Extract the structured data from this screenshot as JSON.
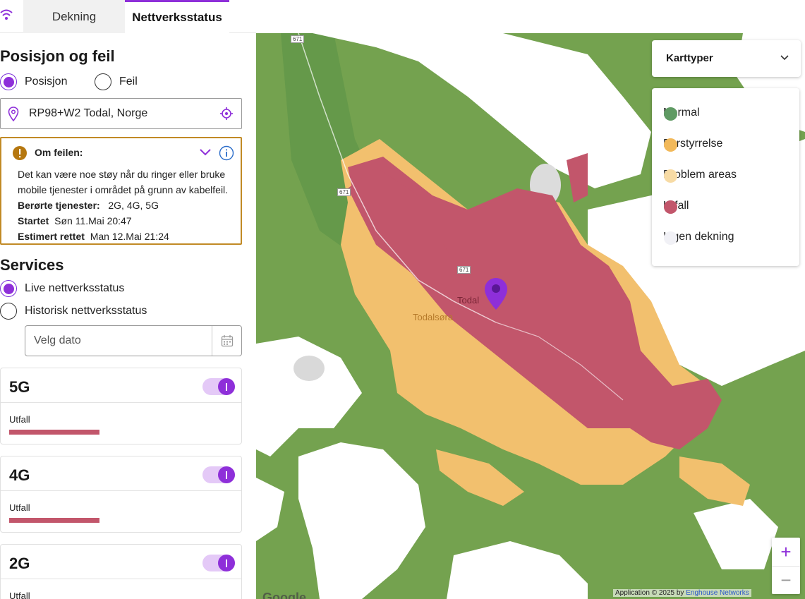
{
  "tabs": {
    "coverage": "Dekning",
    "network_status": "Nettverksstatus"
  },
  "position_section": {
    "title": "Posisjon og feil",
    "radio_position": "Posisjon",
    "radio_fault": "Feil",
    "location_value": "RP98+W2 Todal, Norge"
  },
  "alert": {
    "title": "Om feilen:",
    "message": "Det kan være noe støy når du ringer eller bruke mobile tjenester i området på grunn av kabelfeil.",
    "services_label": "Berørte tjenester:",
    "services_value": "2G, 4G, 5G",
    "started_label": "Startet",
    "started_value": "Søn 11.Mai 20:47",
    "est_label": "Estimert rettet",
    "est_value": "Man 12.Mai 21:24"
  },
  "services_section": {
    "title": "Services",
    "radio_live": "Live nettverksstatus",
    "radio_history": "Historisk nettverksstatus",
    "date_placeholder": "Velg dato"
  },
  "network_cards": [
    {
      "name": "5G",
      "status": "Utfall",
      "enabled": true
    },
    {
      "name": "4G",
      "status": "Utfall",
      "enabled": true
    },
    {
      "name": "2G",
      "status": "Utfall",
      "enabled": true
    }
  ],
  "map": {
    "place_todal": "Todal",
    "place_todalsora": "Todalsøra",
    "road_number": "671",
    "map_type_label": "Karttyper",
    "legend": [
      {
        "label": "Normal",
        "color": "#5f9a63"
      },
      {
        "label": "Forstyrrelse",
        "color": "#f2b95a"
      },
      {
        "label": "Problem areas",
        "color": "#f7dba5"
      },
      {
        "label": "Utfall",
        "color": "#c2566b"
      },
      {
        "label": "Ingen dekning",
        "color": "#f1f1f6"
      }
    ],
    "attribution_prefix": "Application © 2025 by",
    "attribution_link": "Enghouse Networks",
    "google": "Google",
    "zoom_in": "+",
    "zoom_out": "−"
  },
  "colors": {
    "accent": "#8e2fd9",
    "outage": "#c2566b",
    "disturbance": "#f2c06e",
    "normal_area": "#74a24f",
    "alert_border": "#c18a25"
  }
}
